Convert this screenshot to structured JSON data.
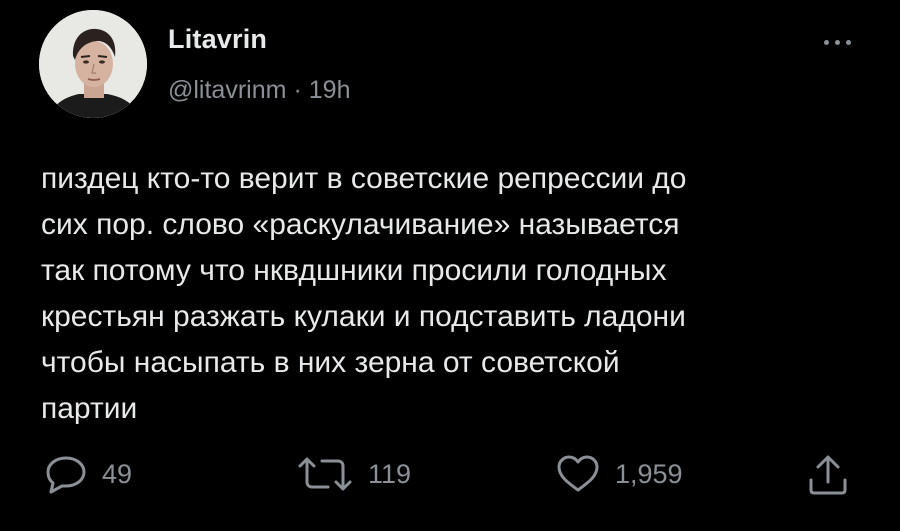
{
  "author": {
    "display_name": "Litavrin",
    "handle": "@litavrinm",
    "separator": "·",
    "time_ago": "19h"
  },
  "tweet": {
    "text": "пиздец кто-то верит в советские репрессии до\nсих пор. слово «раскулачивание» называется\nтак потому что нквдшники просили голодных\nкрестьян разжать кулаки и подставить ладони\nчтобы насыпать в них зерна от советской\nпартии"
  },
  "actions": {
    "reply": {
      "icon": "reply-icon",
      "count": "49"
    },
    "retweet": {
      "icon": "retweet-icon",
      "count": "119"
    },
    "like": {
      "icon": "heart-icon",
      "count": "1,959"
    },
    "share": {
      "icon": "share-icon"
    }
  },
  "more": {
    "icon": "more-dots-icon"
  },
  "colors": {
    "background": "#000000",
    "text_primary": "#e7e9ea",
    "text_secondary": "#8b9096"
  }
}
